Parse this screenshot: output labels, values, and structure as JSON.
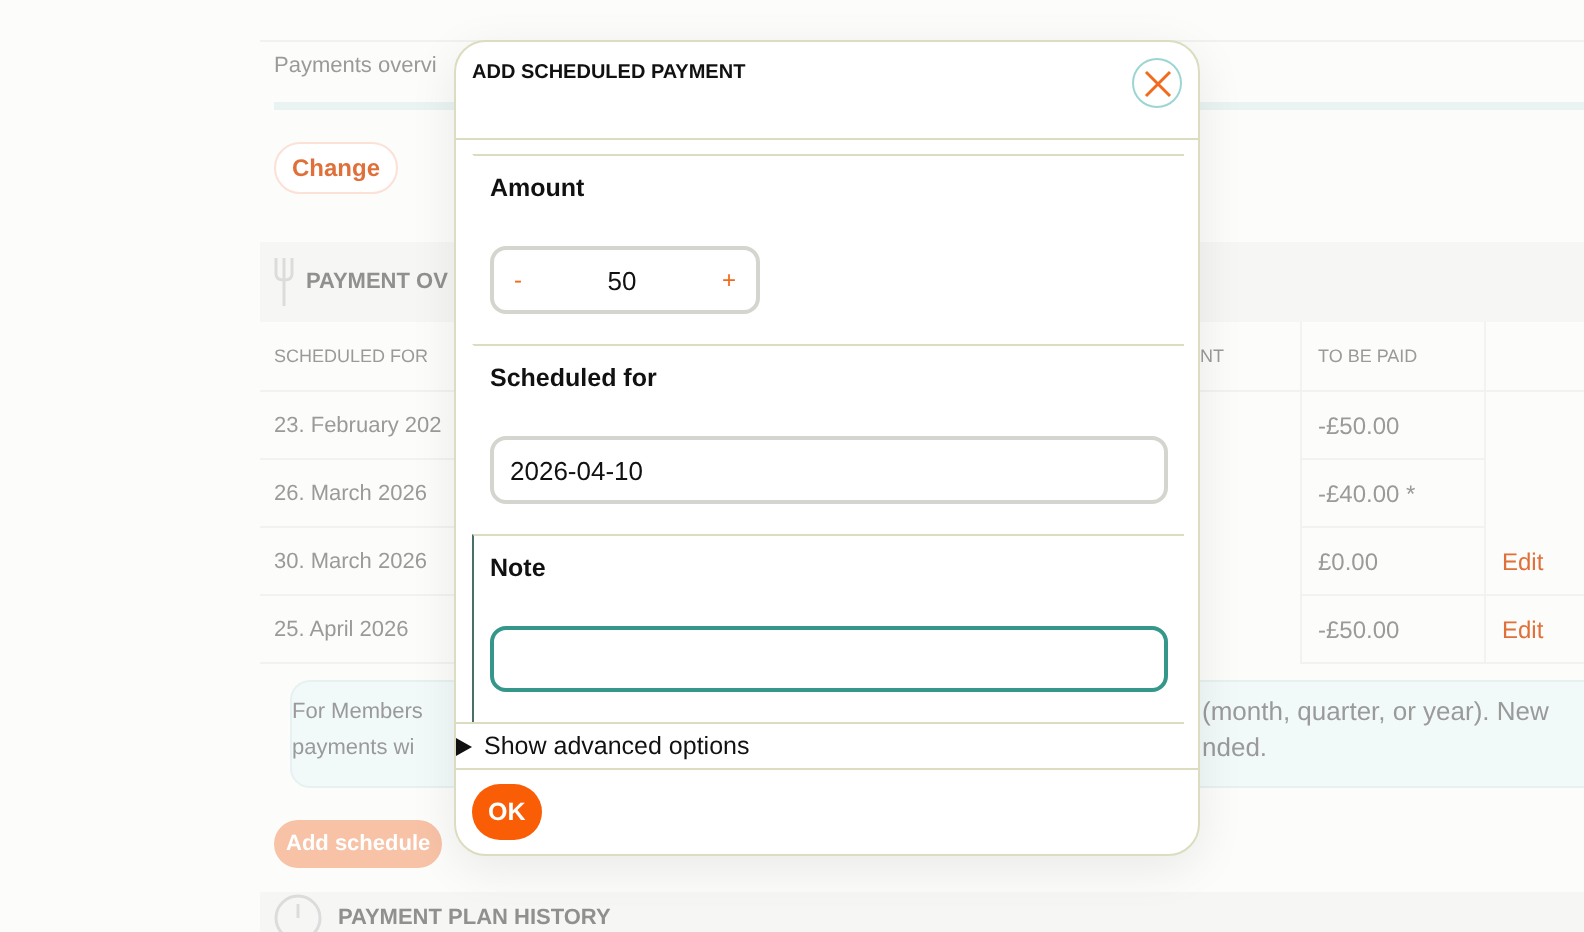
{
  "background": {
    "overview_label": "Payments overvi",
    "change_button": "Change",
    "section_title": "PAYMENT OV",
    "columns": [
      "SCHEDULED FOR",
      "NT",
      "TO BE PAID"
    ],
    "rows": [
      {
        "scheduled_for": "23. February 202",
        "to_be_paid": "-£50.00"
      },
      {
        "scheduled_for": "26. March 2026",
        "to_be_paid": "-£40.00 *"
      },
      {
        "scheduled_for": "30. March 2026",
        "to_be_paid": "£0.00",
        "action": "Edit"
      },
      {
        "scheduled_for": "25. April 2026",
        "to_be_paid": "-£50.00",
        "action": "Edit"
      }
    ],
    "info_left": [
      "For Members",
      "payments wi"
    ],
    "info_right": [
      "(month, quarter, or year). New",
      "nded."
    ],
    "add_button": "Add schedule",
    "history_title": "PAYMENT PLAN HISTORY"
  },
  "dialog": {
    "title": "ADD SCHEDULED PAYMENT",
    "fields": [
      {
        "kind": "stepper",
        "label": "Amount",
        "value": "50",
        "decrement": "-",
        "increment": "+",
        "focused": false
      },
      {
        "kind": "text",
        "label": "Scheduled for",
        "value": "2026-04-10",
        "focused": false
      },
      {
        "kind": "text",
        "label": "Note",
        "focused": true
      }
    ],
    "disclosure": {
      "label": "Show advanced options",
      "expanded": false
    },
    "ok_button": "OK"
  }
}
